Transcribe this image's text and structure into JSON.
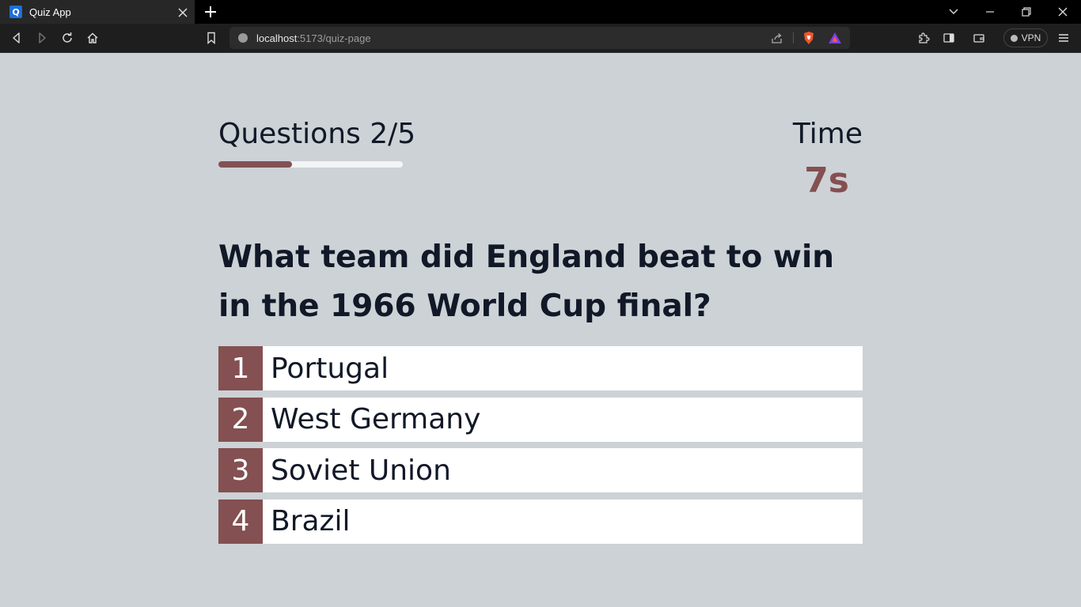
{
  "browser": {
    "tab_title": "Quiz App",
    "tab_favicon": "Q",
    "url_host": "localhost",
    "url_path": ":5173/quiz-page",
    "vpn_label": "VPN"
  },
  "quiz": {
    "counter_label": "Questions 2/5",
    "progress_fraction": 0.4,
    "time_label": "Time",
    "time_value": "7s",
    "question": "What team did England beat to win in the 1966 World Cup final?",
    "options": [
      {
        "number": "1",
        "text": "Portugal"
      },
      {
        "number": "2",
        "text": "West Germany"
      },
      {
        "number": "3",
        "text": "Soviet Union"
      },
      {
        "number": "4",
        "text": "Brazil"
      }
    ]
  },
  "colors": {
    "accent": "#845052",
    "background": "#cdd2d6",
    "text": "#111827"
  }
}
